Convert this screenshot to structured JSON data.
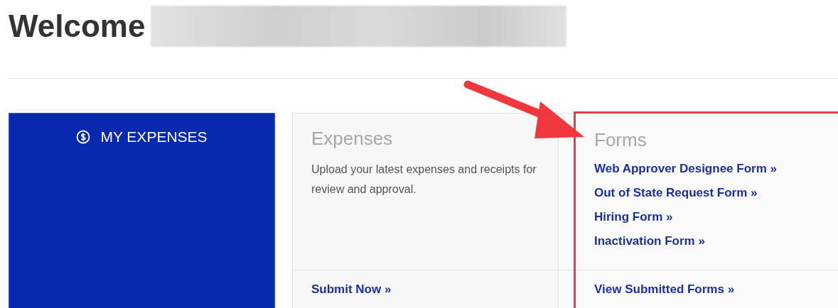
{
  "heading": {
    "title": "Welcome"
  },
  "tile": {
    "label": "MY EXPENSES"
  },
  "cards": [
    {
      "kind": "text",
      "title": "Expenses",
      "body": "Upload your latest expenses and receipts for review and approval.",
      "footer_link": "Submit Now »",
      "highlighted": false
    },
    {
      "kind": "links",
      "title": "Forms",
      "links": [
        "Web Approver Designee Form »",
        "Out of State Request Form »",
        "Hiring Form »",
        "Inactivation Form »"
      ],
      "footer_link": "View Submitted Forms »",
      "highlighted": true
    }
  ],
  "annotations": [
    {
      "kind": "arrow"
    }
  ]
}
